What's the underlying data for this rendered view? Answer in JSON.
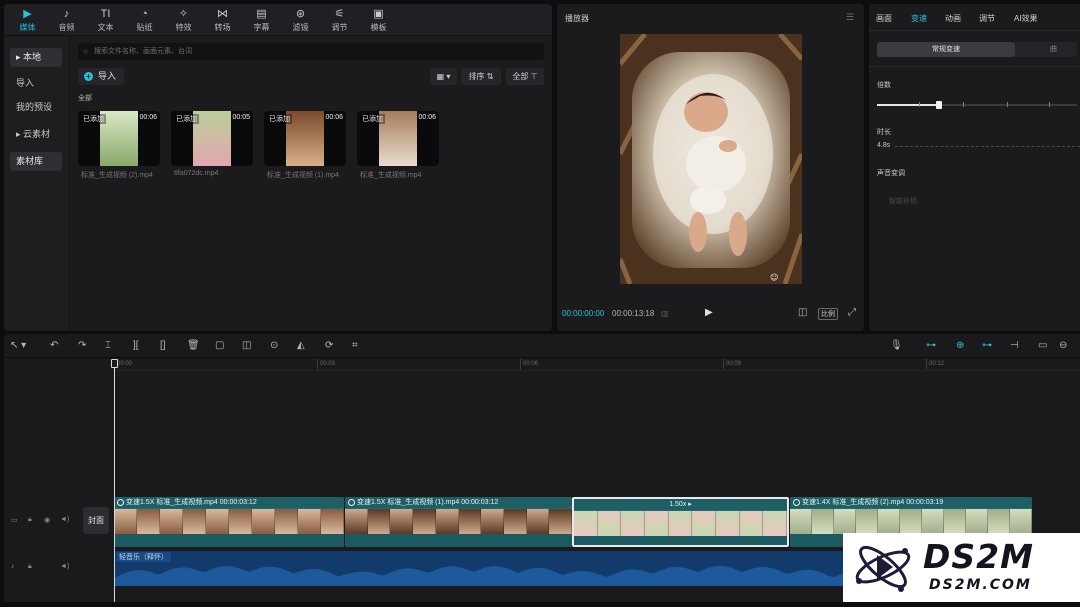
{
  "media_toolbar": [
    {
      "label": "媒体",
      "icon": "media-icon",
      "icon_glyph": "▶"
    },
    {
      "label": "音频",
      "icon": "audio-icon",
      "icon_glyph": "♪"
    },
    {
      "label": "文本",
      "icon": "text-icon",
      "icon_glyph": "TI"
    },
    {
      "label": "贴纸",
      "icon": "sticker-icon",
      "icon_glyph": "◔"
    },
    {
      "label": "特效",
      "icon": "effects-icon",
      "icon_glyph": "✧"
    },
    {
      "label": "转场",
      "icon": "transition-icon",
      "icon_glyph": "⋈"
    },
    {
      "label": "字幕",
      "icon": "subtitle-icon",
      "icon_glyph": "▤"
    },
    {
      "label": "滤镜",
      "icon": "filter-icon",
      "icon_glyph": "⊛"
    },
    {
      "label": "调节",
      "icon": "adjust-icon",
      "icon_glyph": "⚟"
    },
    {
      "label": "模板",
      "icon": "template-icon",
      "icon_glyph": "▣"
    }
  ],
  "sidebar": {
    "local": "本地",
    "import": "导入",
    "presets": "我的预设",
    "cloud": "云素材",
    "library": "素材库"
  },
  "search_placeholder": "搜索文件名称、画面元素、台词",
  "import_label": "导入",
  "sort_label": "排序",
  "all_filter_label": "全部",
  "section_label": "全部",
  "media_items": [
    {
      "added": "已添加",
      "duration": "00:06",
      "name": "标准_生成视频 (2).mp4",
      "c1": "#d9e8c6",
      "c2": "#8aa86a"
    },
    {
      "added": "已添加",
      "duration": "00:05",
      "name": "6fa072dc.mp4",
      "c1": "#b9cf9a",
      "c2": "#e3a6b0"
    },
    {
      "added": "已添加",
      "duration": "00:06",
      "name": "标准_生成视频 (1).mp4",
      "c1": "#7a4a2a",
      "c2": "#d8b08a"
    },
    {
      "added": "已添加",
      "duration": "00:06",
      "name": "标准_生成视频.mp4",
      "c1": "#a87c5a",
      "c2": "#e9ddd0"
    }
  ],
  "player": {
    "title": "播放器",
    "current_time": "00:00:00:00",
    "total_time": "00:00:13:18",
    "ratio_label": "比例"
  },
  "props": {
    "tabs": [
      "画面",
      "变速",
      "动画",
      "调节",
      "AI效果"
    ],
    "active_tab": "变速",
    "segment_on": "常规变速",
    "segment_off": "曲",
    "speed_label": "倍数",
    "duration_label": "时长",
    "duration_value": "4.8s",
    "pitch_label": "声音变调",
    "smart_label": "智能补帧",
    "speed_fraction": 0.31
  },
  "timeline": {
    "ruler": [
      "00:00",
      "00:03",
      "00:06",
      "00:09",
      "00:12"
    ],
    "cover_label": "封面",
    "clips": [
      {
        "text": "变速1.5X  标准_生成视频.mp4  00:00:03:12"
      },
      {
        "text": "变速1.5X  标准_生成视频 (1).mp4  00:00:03:12"
      },
      {
        "text": "1.50x ▸"
      },
      {
        "text": "变速1.4X  标准_生成视频 (2).mp4  00:00:03:19"
      }
    ],
    "audio_label": "轻音乐（释怀）"
  },
  "watermark": {
    "big": "DS2M",
    "small": "DS2M.COM"
  },
  "colors": {
    "accent": "#27c3d6",
    "clip": "#1f6c72",
    "audio": "#123a6a"
  }
}
